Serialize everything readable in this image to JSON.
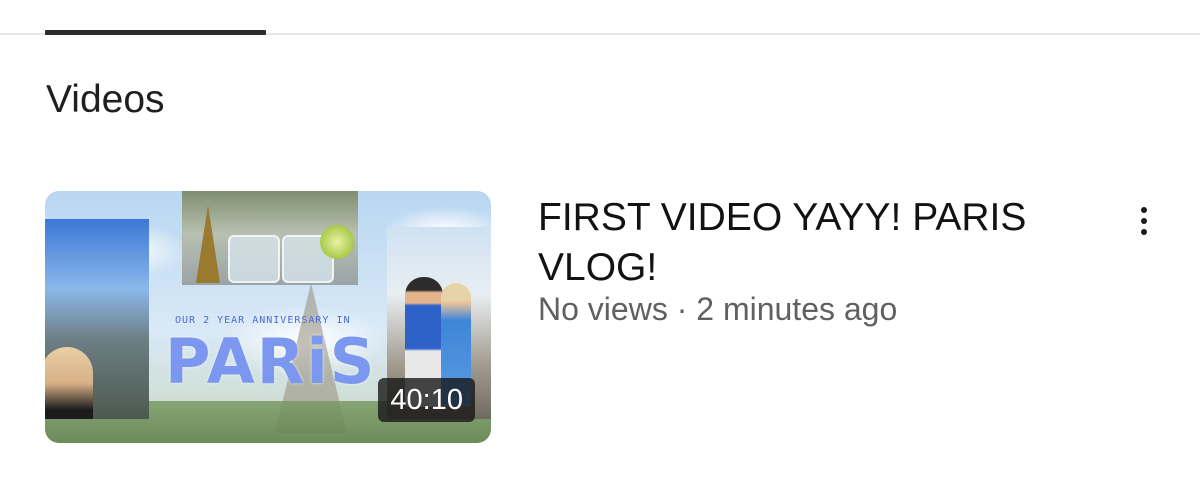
{
  "tabs": {
    "active_index": 0
  },
  "section": {
    "title": "Videos"
  },
  "video": {
    "title": "FIRST VIDEO YAYY! PARIS VLOG!",
    "views": "No views",
    "separator": "·",
    "uploaded": "2 minutes ago",
    "duration": "40:10",
    "thumbnail": {
      "subtitle_text": "OUR 2 YEAR ANNIVERSARY IN",
      "headline_text": "PARiS"
    },
    "menu_icon": "more-vert-icon"
  },
  "colors": {
    "tab_underline": "#2b2b2b",
    "title_text": "#121212",
    "meta_text": "#606060",
    "duration_bg": "#141414",
    "thumb_headline": "#7b97f0"
  }
}
